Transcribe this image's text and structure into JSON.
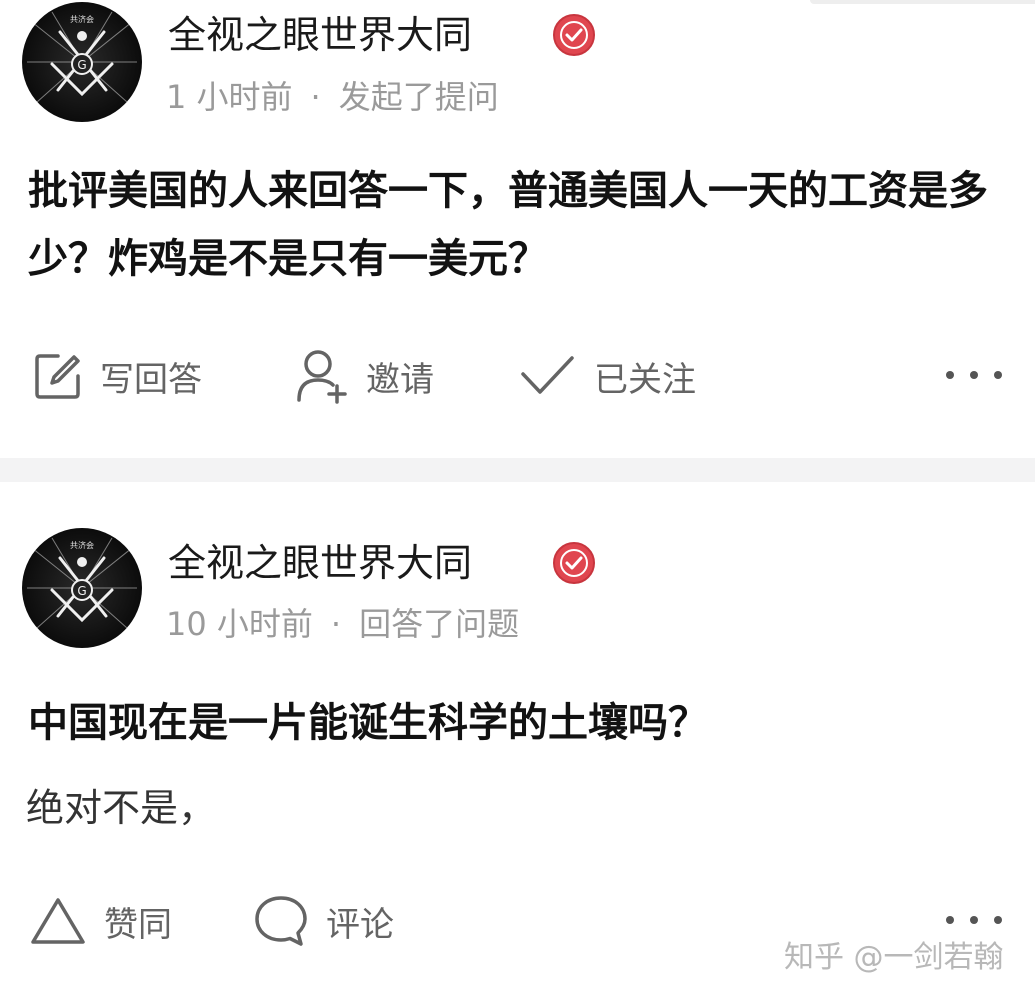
{
  "feed": [
    {
      "author": {
        "name": "全视之眼世界大同",
        "avatar_badge_text": "共济会"
      },
      "meta": {
        "time": "1 小时前",
        "separator": "·",
        "activity": "发起了提问"
      },
      "title": "批评美国的人来回答一下，普通美国人一天的工资是多少？炸鸡是不是只有一美元？",
      "actions": [
        {
          "icon": "edit-icon",
          "label": "写回答"
        },
        {
          "icon": "invite-user-icon",
          "label": "邀请"
        },
        {
          "icon": "check-icon",
          "label": "已关注"
        }
      ]
    },
    {
      "author": {
        "name": "全视之眼世界大同",
        "avatar_badge_text": "共济会"
      },
      "meta": {
        "time": "10 小时前",
        "separator": "·",
        "activity": "回答了问题"
      },
      "title": "中国现在是一片能诞生科学的土壤吗？",
      "excerpt": "绝对不是，",
      "actions": [
        {
          "icon": "upvote-triangle-icon",
          "label": "赞同"
        },
        {
          "icon": "comment-bubble-icon",
          "label": "评论"
        }
      ]
    }
  ],
  "watermark": "知乎 @一剑若翰",
  "colors": {
    "text_primary": "#121212",
    "text_secondary": "#9a9a9a",
    "action_gray": "#646464",
    "verified_red": "#e0464f",
    "separator": "#f3f3f4"
  }
}
